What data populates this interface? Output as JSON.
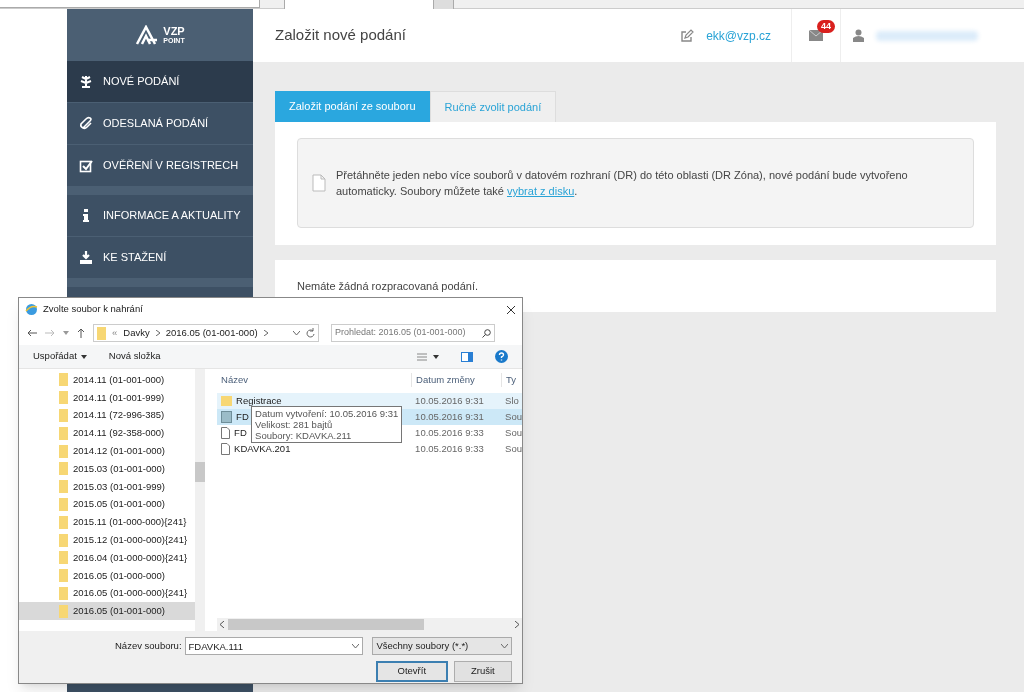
{
  "sidebar": {
    "logo": {
      "line1": "VZP",
      "line2": "POINT"
    },
    "groups": [
      {
        "items": [
          {
            "label": "NOVÉ PODÁNÍ",
            "kind": "leaf",
            "selected": true
          },
          {
            "label": "ODESLANÁ PODÁNÍ",
            "kind": "clip",
            "selected": false
          },
          {
            "label": "OVĚŘENÍ V REGISTRECH",
            "kind": "check",
            "selected": false
          }
        ]
      },
      {
        "items": [
          {
            "label": "INFORMACE A AKTUALITY",
            "kind": "info",
            "selected": false
          },
          {
            "label": "KE STAŽENÍ",
            "kind": "download",
            "selected": false
          }
        ]
      }
    ]
  },
  "header": {
    "title": "Založit nové podání",
    "email": "ekk@vzp.cz",
    "messages_badge": "44"
  },
  "tabs": [
    {
      "label": "Založit podání ze souboru",
      "selected": true
    },
    {
      "label": "Ručně zvolit podání",
      "selected": false
    }
  ],
  "dropzone": {
    "text": "Přetáhněte jeden nebo více souborů v datovém rozhraní (DR) do této oblasti (DR Zóna), nové podání bude vytvořeno automaticky. Soubory můžete také ",
    "link": "vybrat z disku",
    "after": "."
  },
  "drafts_message": "Nemáte žádná rozpracovaná podání.",
  "dialog": {
    "title": "Zvolte soubor k nahrání",
    "path_prefix": "«",
    "path": [
      "Davky",
      "2016.05 (01-001-000)"
    ],
    "search_placeholder": "Prohledat: 2016.05 (01-001-000)",
    "organize": "Uspořádat",
    "new_folder": "Nová složka",
    "tree": [
      {
        "label": "2014.11 (01-001-000)",
        "selected": false
      },
      {
        "label": "2014.11 (01-001-999)",
        "selected": false
      },
      {
        "label": "2014.11 (72-996-385)",
        "selected": false
      },
      {
        "label": "2014.11 (92-358-000)",
        "selected": false
      },
      {
        "label": "2014.12 (01-001-000)",
        "selected": false
      },
      {
        "label": "2015.03 (01-001-000)",
        "selected": false
      },
      {
        "label": "2015.03 (01-001-999)",
        "selected": false
      },
      {
        "label": "2015.05 (01-001-000)",
        "selected": false
      },
      {
        "label": "2015.11 (01-000-000){241}",
        "selected": false
      },
      {
        "label": "2015.12 (01-000-000){241}",
        "selected": false
      },
      {
        "label": "2016.04 (01-000-000){241}",
        "selected": false
      },
      {
        "label": "2016.05 (01-000-000)",
        "selected": false
      },
      {
        "label": "2016.05 (01-000-000){241}",
        "selected": false
      },
      {
        "label": "2016.05 (01-001-000)",
        "selected": true
      }
    ],
    "columns": [
      "Název",
      "Datum změny",
      "Ty"
    ],
    "files": [
      {
        "name": "Registrace",
        "date": "10.05.2016 9:31",
        "type": "Slo",
        "kind": "folder",
        "selected": true
      },
      {
        "name": "FD",
        "date": "10.05.2016 9:31",
        "type": "Sou",
        "kind": "doc",
        "selected": true
      },
      {
        "name": "FD",
        "date": "10.05.2016 9:33",
        "type": "Sou",
        "kind": "file",
        "selected": false
      },
      {
        "name": "KDAVKA.201",
        "date": "10.05.2016 9:33",
        "type": "Sou",
        "kind": "file",
        "selected": false
      }
    ],
    "tooltip": [
      "Datum vytvoření: 10.05.2016 9:31",
      "Velikost: 281 bajtů",
      "Soubory: KDAVKA.211"
    ],
    "filename_label": "Název souboru:",
    "filename": "FDAVKA.111",
    "filetype": "Všechny soubory (*.*)",
    "open_button": "Otevřít",
    "cancel_button": "Zrušit"
  }
}
